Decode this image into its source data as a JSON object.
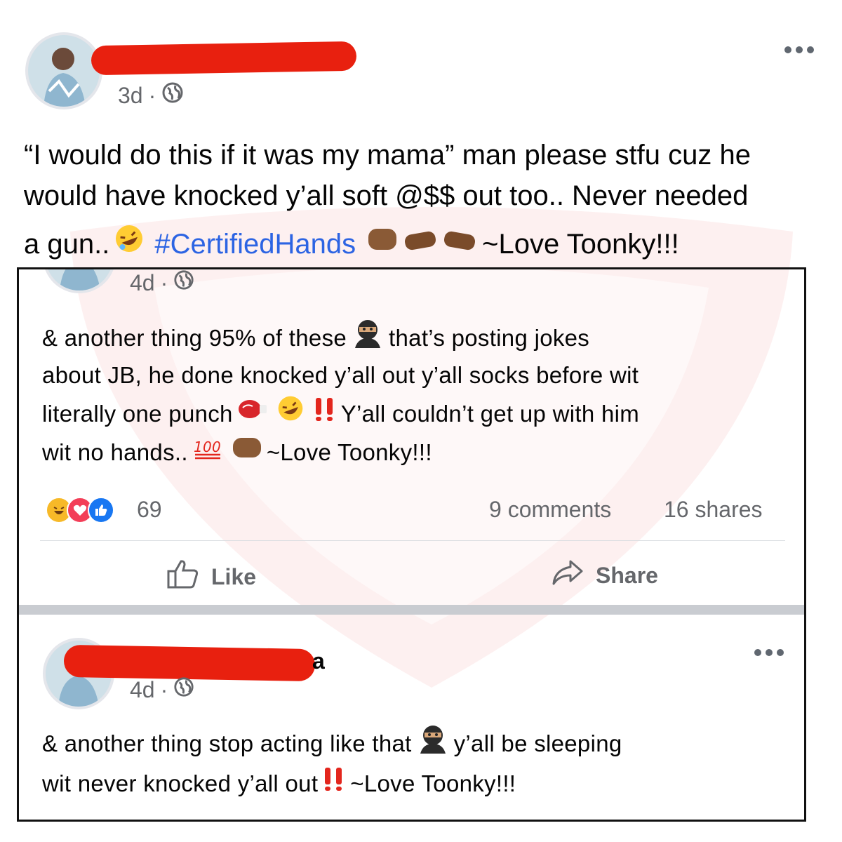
{
  "main_post": {
    "time": "3d",
    "separator": "·",
    "lines": [
      "“I would do this if it was my mama” man please stfu cuz he",
      "would have knocked y’all soft @$$ out too.. Never needed",
      "a gun.."
    ],
    "hashtag": "#CertifiedHands",
    "signoff": "~Love Toonky!!!"
  },
  "screenshot_post_1": {
    "time": "4d",
    "separator": "·",
    "line1_a": "& another thing 95% of these",
    "line1_b": "that’s posting jokes",
    "line2": "about JB, he done knocked y’all out y’all socks before wit",
    "line3_a": "literally one punch",
    "line3_b": "Y’all couldn’t get up with him",
    "line4_a": "wit no hands..",
    "line4_b": "~Love Toonky!!!",
    "reaction_count": "69",
    "comments": "9 comments",
    "shares": "16 shares",
    "like_label": "Like",
    "share_label": "Share"
  },
  "screenshot_post_2": {
    "name_visible_fragment": "a",
    "time": "4d",
    "separator": "·",
    "line1_a": "& another thing stop acting like that",
    "line1_b": "y’all be sleeping",
    "line2_a": "wit never knocked y’all out",
    "line2_b": "~Love Toonky!!!"
  },
  "colors": {
    "redaction": "#e8200f",
    "hashtag": "#2c64e3",
    "meta_gray": "#65676b"
  }
}
